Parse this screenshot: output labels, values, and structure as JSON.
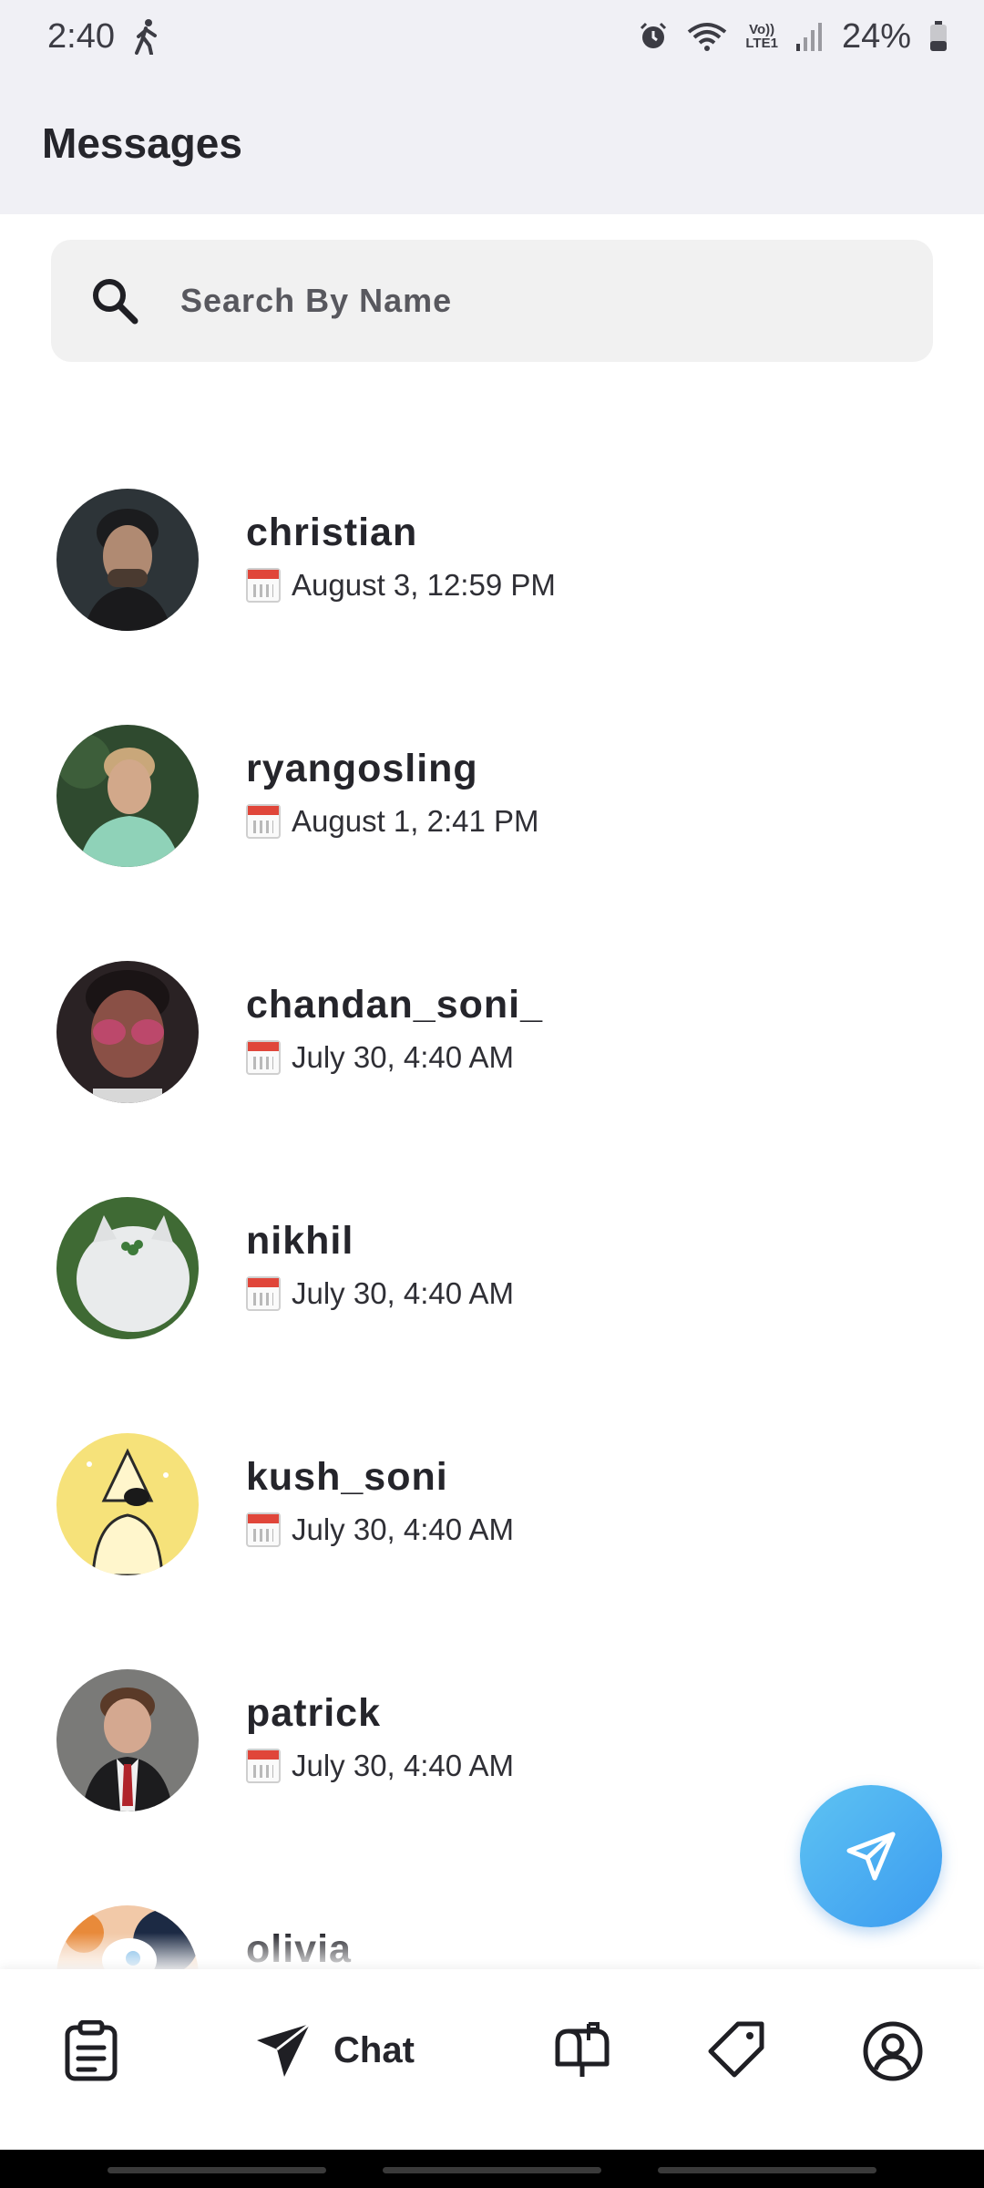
{
  "status_bar": {
    "time": "2:40",
    "volte_top": "Vo))",
    "volte_bottom": "LTE1",
    "battery": "24%"
  },
  "header": {
    "title": "Messages"
  },
  "search": {
    "placeholder": "Search By Name"
  },
  "chats": [
    {
      "name": "christian",
      "date": "August 3, 12:59 PM"
    },
    {
      "name": "ryangosling",
      "date": "August 1, 2:41 PM"
    },
    {
      "name": "chandan_soni_",
      "date": "July 30, 4:40 AM"
    },
    {
      "name": "nikhil",
      "date": "July 30, 4:40 AM"
    },
    {
      "name": "kush_soni",
      "date": "July 30, 4:40 AM"
    },
    {
      "name": "patrick",
      "date": "July 30, 4:40 AM"
    },
    {
      "name": "olivia",
      "date": ""
    }
  ],
  "bottom_nav": {
    "items": [
      {
        "icon": "clipboard-icon"
      },
      {
        "icon": "send-icon",
        "label": "Chat"
      },
      {
        "icon": "mailbox-icon"
      },
      {
        "icon": "tag-icon"
      },
      {
        "icon": "profile-icon"
      }
    ]
  },
  "colors": {
    "accent": "#3b9bf0",
    "header_bg": "#f0f0f5",
    "search_bg": "#f1f1f1"
  }
}
